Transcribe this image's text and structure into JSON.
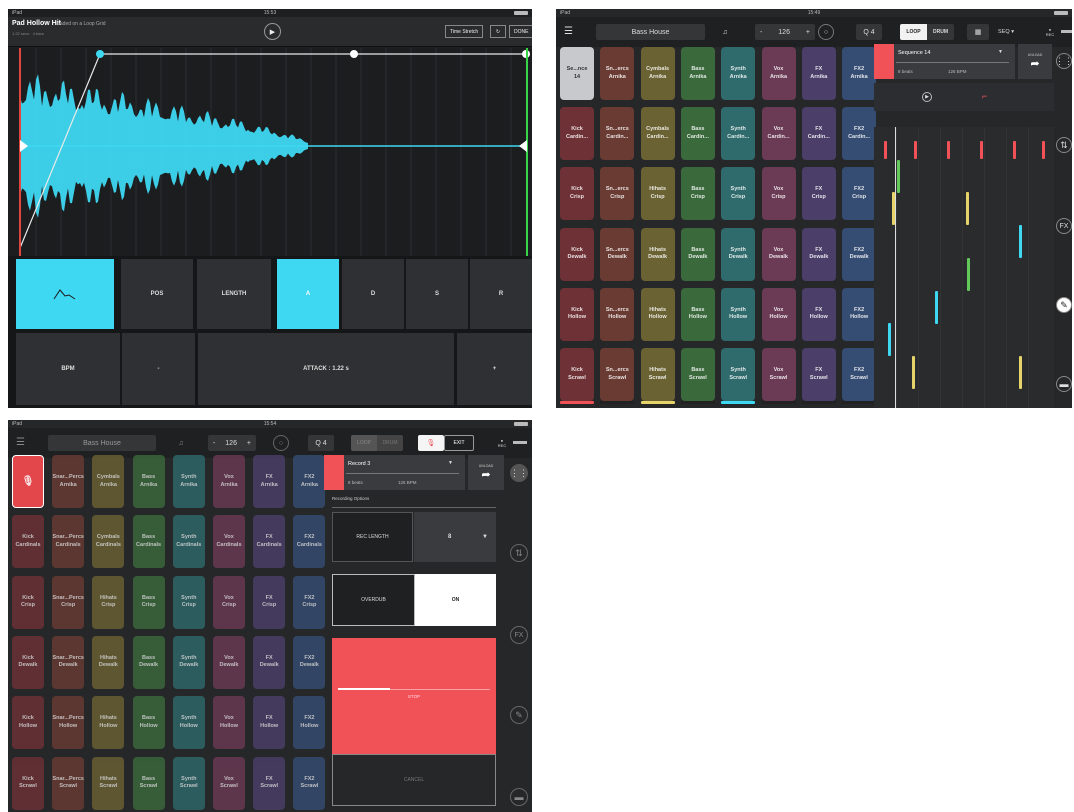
{
  "screen1": {
    "status_time": "15:53",
    "status_left": "iPad",
    "title": "Pad Hollow Hit",
    "subtitle": "loaded on a Loop Grid",
    "info": "1.22 secs · 4 bars",
    "time_stretch": "Time Stretch",
    "done": "DONE",
    "tiles": {
      "pos": "POS",
      "length": "LENGTH",
      "a": "A",
      "d": "D",
      "s": "S",
      "r": "R",
      "bpm": "BPM",
      "minus": "-",
      "attack": "ATTACK : 1.22 s",
      "plus": "+"
    },
    "accent": "#3fd8f2"
  },
  "screen2": {
    "status_time": "15:49",
    "status_left": "iPad",
    "project": "Bass House",
    "bpm_minus": "-",
    "bpm": "126",
    "bpm_plus": "+",
    "quantize": "Q 4",
    "loop": "LOOP",
    "drum": "DRUM",
    "seq": "SEQ ▾",
    "rec": "REC",
    "sequence_name": "Sequence 14",
    "beats": "8 beats",
    "seq_bpm": "126 BPM",
    "unload": "UNLOAD",
    "fx": "FX",
    "selected_pad": [
      "Se...nce",
      "14"
    ],
    "rows": [
      [
        [
          "Sn...ercs",
          "Arnika"
        ],
        [
          "Cymbals",
          "Arnika"
        ],
        [
          "Bass",
          "Arnika"
        ],
        [
          "Synth",
          "Arnika"
        ],
        [
          "Vox",
          "Arnika"
        ],
        [
          "FX",
          "Arnika"
        ],
        [
          "FX2",
          "Arnika"
        ]
      ],
      [
        [
          "Kick",
          "Cardin..."
        ],
        [
          "Sn...ercs",
          "Cardin..."
        ],
        [
          "Cymbals",
          "Cardin..."
        ],
        [
          "Bass",
          "Cardin..."
        ],
        [
          "Synth",
          "Cardin..."
        ],
        [
          "Vox",
          "Cardin..."
        ],
        [
          "FX",
          "Cardin..."
        ],
        [
          "FX2",
          "Cardin..."
        ]
      ],
      [
        [
          "Kick",
          "Crisp"
        ],
        [
          "Sn...ercs",
          "Crisp"
        ],
        [
          "Hihats",
          "Crisp"
        ],
        [
          "Bass",
          "Crisp"
        ],
        [
          "Synth",
          "Crisp"
        ],
        [
          "Vox",
          "Crisp"
        ],
        [
          "FX",
          "Crisp"
        ],
        [
          "FX2",
          "Crisp"
        ]
      ],
      [
        [
          "Kick",
          "Dewalk"
        ],
        [
          "Sn...ercs",
          "Dewalk"
        ],
        [
          "Hihats",
          "Dewalk"
        ],
        [
          "Bass",
          "Dewalk"
        ],
        [
          "Synth",
          "Dewalk"
        ],
        [
          "Vox",
          "Dewalk"
        ],
        [
          "FX",
          "Dewalk"
        ],
        [
          "FX2",
          "Dewalk"
        ]
      ],
      [
        [
          "Kick",
          "Hollow"
        ],
        [
          "Sn...ercs",
          "Hollow"
        ],
        [
          "Hihats",
          "Hollow"
        ],
        [
          "Bass",
          "Hollow"
        ],
        [
          "Synth",
          "Hollow"
        ],
        [
          "Vox",
          "Hollow"
        ],
        [
          "FX",
          "Hollow"
        ],
        [
          "FX2",
          "Hollow"
        ]
      ],
      [
        [
          "Kick",
          "Scrawl"
        ],
        [
          "Sn...ercs",
          "Scrawl"
        ],
        [
          "Hihats",
          "Scrawl"
        ],
        [
          "Bass",
          "Scrawl"
        ],
        [
          "Synth",
          "Scrawl"
        ],
        [
          "Vox",
          "Scrawl"
        ],
        [
          "FX",
          "Scrawl"
        ],
        [
          "FX2",
          "Scrawl"
        ]
      ]
    ]
  },
  "screen3": {
    "status_time": "15:54",
    "status_left": "iPad",
    "project": "Bass House",
    "bpm_minus": "-",
    "bpm": "126",
    "bpm_plus": "+",
    "quantize": "Q 4",
    "loop": "LOOP",
    "drum": "DRUM",
    "exit": "EXIT",
    "rec": "REC",
    "record_name": "Record 3",
    "beats": "8 beats",
    "rec_bpm": "126 BPM",
    "unload": "UNLOAD",
    "recording_options": "Recording Options",
    "rec_length": "REC LENGTH",
    "rec_length_value": "8",
    "overdub": "OVERDUB",
    "overdub_value": "ON",
    "stop": "STOP",
    "cancel": "CANCEL",
    "fx": "FX",
    "rows": [
      [
        [
          "Snar...Percs",
          "Arnika"
        ],
        [
          "Cymbals",
          "Arnika"
        ],
        [
          "Bass",
          "Arnika"
        ],
        [
          "Synth",
          "Arnika"
        ],
        [
          "Vox",
          "Arnika"
        ],
        [
          "FX",
          "Arnika"
        ],
        [
          "FX2",
          "Arnika"
        ]
      ],
      [
        [
          "Kick",
          "Cardinals"
        ],
        [
          "Snar...Percs",
          "Cardinals"
        ],
        [
          "Cymbals",
          "Cardinals"
        ],
        [
          "Bass",
          "Cardinals"
        ],
        [
          "Synth",
          "Cardinals"
        ],
        [
          "Vox",
          "Cardinals"
        ],
        [
          "FX",
          "Cardinals"
        ],
        [
          "FX2",
          "Cardinals"
        ]
      ],
      [
        [
          "Kick",
          "Crisp"
        ],
        [
          "Snar...Percs",
          "Crisp"
        ],
        [
          "Hihats",
          "Crisp"
        ],
        [
          "Bass",
          "Crisp"
        ],
        [
          "Synth",
          "Crisp"
        ],
        [
          "Vox",
          "Crisp"
        ],
        [
          "FX",
          "Crisp"
        ],
        [
          "FX2",
          "Crisp"
        ]
      ],
      [
        [
          "Kick",
          "Dewalk"
        ],
        [
          "Snar...Percs",
          "Dewalk"
        ],
        [
          "Hihats",
          "Dewalk"
        ],
        [
          "Bass",
          "Dewalk"
        ],
        [
          "Synth",
          "Dewalk"
        ],
        [
          "Vox",
          "Dewalk"
        ],
        [
          "FX",
          "Dewalk"
        ],
        [
          "FX2",
          "Dewalk"
        ]
      ],
      [
        [
          "Kick",
          "Hollow"
        ],
        [
          "Snar...Percs",
          "Hollow"
        ],
        [
          "Hihats",
          "Hollow"
        ],
        [
          "Bass",
          "Hollow"
        ],
        [
          "Synth",
          "Hollow"
        ],
        [
          "Vox",
          "Hollow"
        ],
        [
          "FX",
          "Hollow"
        ],
        [
          "FX2",
          "Hollow"
        ]
      ],
      [
        [
          "Kick",
          "Scrawl"
        ],
        [
          "Snar...Percs",
          "Scrawl"
        ],
        [
          "Hihats",
          "Scrawl"
        ],
        [
          "Bass",
          "Scrawl"
        ],
        [
          "Synth",
          "Scrawl"
        ],
        [
          "Vox",
          "Scrawl"
        ],
        [
          "FX",
          "Scrawl"
        ],
        [
          "FX2",
          "Scrawl"
        ]
      ]
    ]
  },
  "pad_colors": [
    "#6e3136",
    "#6a3b33",
    "#6b6233",
    "#3a6a3c",
    "#2f6a6c",
    "#6b3a55",
    "#4b3f6a",
    "#364d73"
  ],
  "accent_red": "#f05258"
}
